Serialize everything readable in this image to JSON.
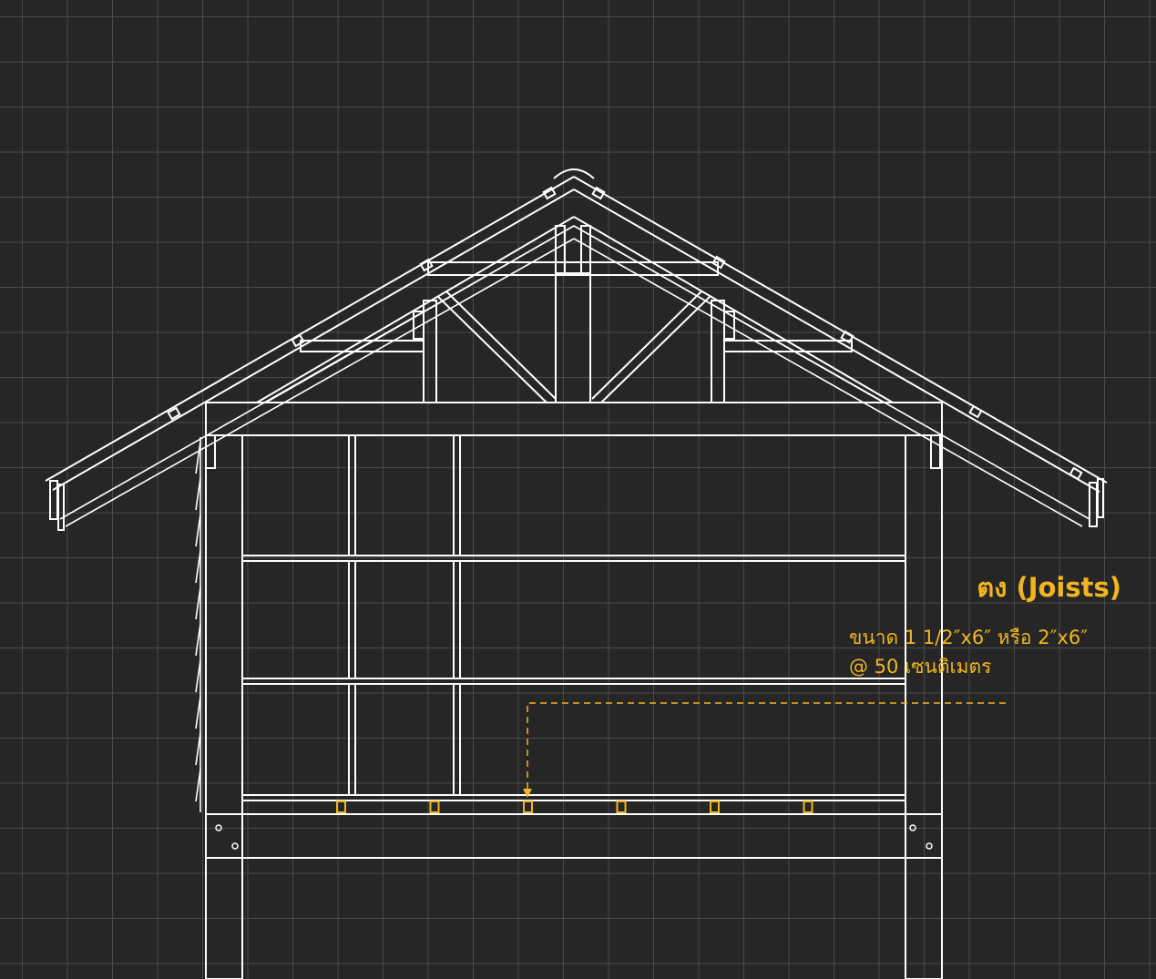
{
  "annotation": {
    "title": "ตง (Joists)",
    "size_text": "ขนาด 1 1/2″x6″ หรือ 2″x6″",
    "spacing_text": "@ 50 เซนติเมตร"
  },
  "colors": {
    "background": "#262626",
    "grid": "#4a4a4a",
    "linework": "#ffffff",
    "highlight": "#f2b51f"
  },
  "joists": {
    "count": 6,
    "highlighted_index": 2
  }
}
